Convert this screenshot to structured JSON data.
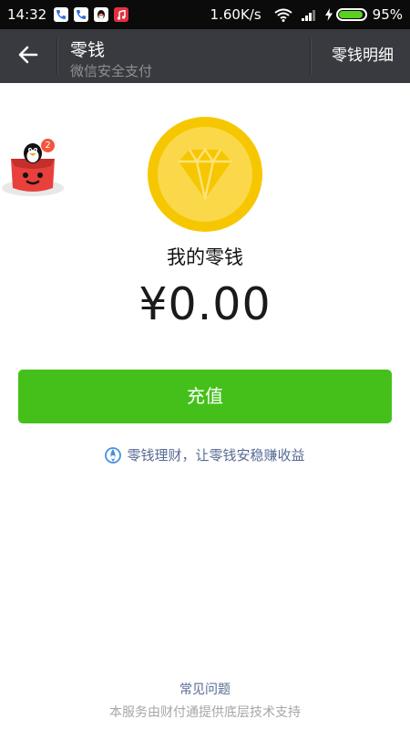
{
  "status_bar": {
    "time": "14:32",
    "network_speed": "1.60K/s",
    "battery_percent": "95%",
    "battery_level": 0.95,
    "icons": [
      "phone-icon",
      "phone-icon",
      "qq-icon",
      "music-icon",
      "wifi-icon",
      "signal-icon",
      "charging-icon",
      "battery-icon"
    ]
  },
  "header": {
    "title": "零钱",
    "subtitle": "微信安全支付",
    "detail_link": "零钱明细",
    "back_icon": "arrow-left-icon",
    "background": "#393a3f"
  },
  "floating_widget": {
    "badge_count": "2",
    "icon": "qq-penguin-icon"
  },
  "main": {
    "coin_icon": "diamond-coin-icon",
    "wallet_label": "我的零钱",
    "amount": "¥0.00",
    "recharge_button": "充值",
    "licai_link": "零钱理财，让零钱安稳赚收益",
    "accent_green": "#45c01a",
    "link_color": "#576b95"
  },
  "footer": {
    "faq_link": "常见问题",
    "note": "本服务由财付通提供底层技术支持"
  }
}
